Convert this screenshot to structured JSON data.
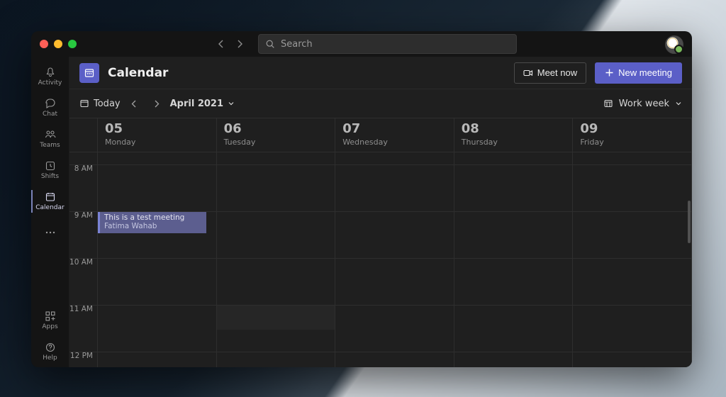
{
  "search": {
    "placeholder": "Search"
  },
  "sidebar": {
    "items": [
      {
        "label": "Activity"
      },
      {
        "label": "Chat"
      },
      {
        "label": "Teams"
      },
      {
        "label": "Shifts"
      },
      {
        "label": "Calendar"
      },
      {
        "label": "Apps"
      },
      {
        "label": "Help"
      }
    ]
  },
  "header": {
    "title": "Calendar",
    "meet_now": "Meet now",
    "new_meeting": "New meeting"
  },
  "toolbar": {
    "today": "Today",
    "month_label": "April 2021",
    "view_label": "Work week"
  },
  "calendar": {
    "time_labels": [
      "8 AM",
      "9 AM",
      "10 AM",
      "11 AM",
      "12 PM"
    ],
    "days": [
      {
        "num": "05",
        "name": "Monday"
      },
      {
        "num": "06",
        "name": "Tuesday"
      },
      {
        "num": "07",
        "name": "Wednesday"
      },
      {
        "num": "08",
        "name": "Thursday"
      },
      {
        "num": "09",
        "name": "Friday"
      }
    ],
    "event": {
      "title": "This is a test meeting",
      "organizer": "Fatima Wahab"
    }
  }
}
